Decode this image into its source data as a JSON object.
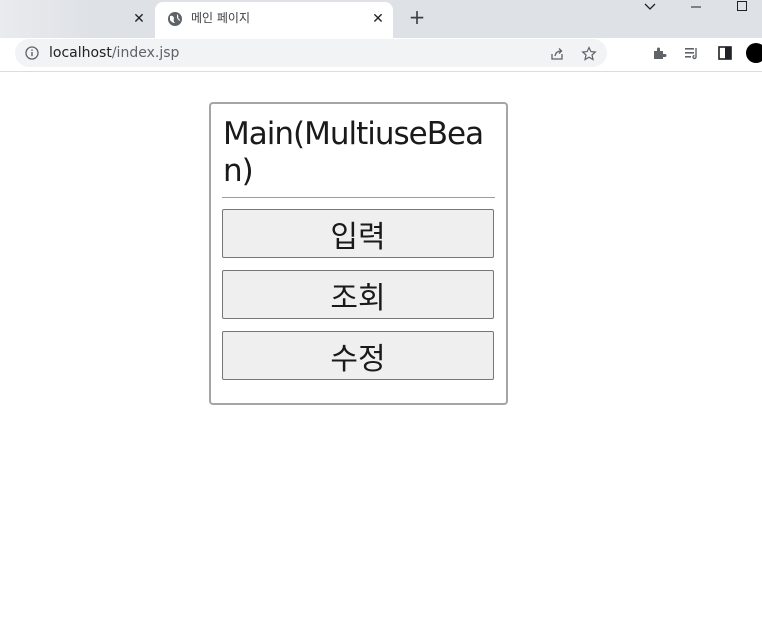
{
  "browser": {
    "active_tab_title": "메인 페이지",
    "tab_close_glyph": "✕",
    "new_tab_glyph": "+",
    "url_host": "localhost",
    "url_path": "/index.jsp"
  },
  "page": {
    "title": "Main(MultiuseBean)",
    "buttons": [
      {
        "label": "입력"
      },
      {
        "label": "조회"
      },
      {
        "label": "수정"
      }
    ]
  },
  "colors": {
    "tabstrip": "#dee1e6",
    "omnibox": "#f1f3f4",
    "card_border": "#a5a5a5",
    "button_bg": "#efefef",
    "button_border": "#767676"
  }
}
